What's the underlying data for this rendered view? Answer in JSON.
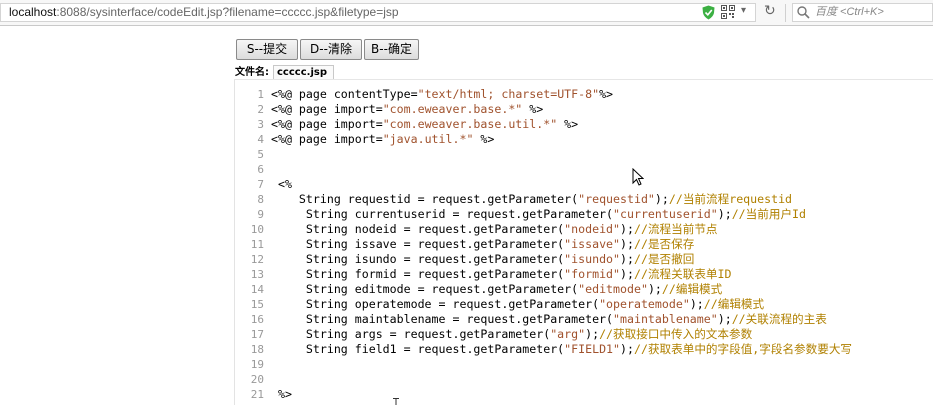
{
  "browser": {
    "url_host": "localhost",
    "url_rest": ":8088/sysinterface/codeEdit.jsp?filename=ccccc.jsp&filetype=jsp",
    "search_placeholder": "百度 <Ctrl+K>",
    "icons": [
      "shield-icon",
      "qr-code-icon",
      "dropdown-caret-icon",
      "reload-icon",
      "search-icon"
    ]
  },
  "toolbar": {
    "submit_label": "S--提交",
    "clear_label": "D--清除",
    "confirm_label": "B--确定"
  },
  "file": {
    "label": "文件名:",
    "name": "ccccc.jsp"
  },
  "editor": {
    "lines": [
      [
        {
          "t": "<%@ page contentType="
        },
        {
          "s": "\"text/html; charset=UTF-8\""
        },
        {
          "t": "%>"
        }
      ],
      [
        {
          "t": "<%@ page import="
        },
        {
          "s": "\"com.eweaver.base.*\""
        },
        {
          "t": " %>"
        }
      ],
      [
        {
          "t": "<%@ page import="
        },
        {
          "s": "\"com.eweaver.base.util.*\""
        },
        {
          "t": " %>"
        }
      ],
      [
        {
          "t": "<%@ page import="
        },
        {
          "s": "\"java.util.*\""
        },
        {
          "t": " %>"
        }
      ],
      [],
      [],
      [
        {
          "t": " <%"
        }
      ],
      [
        {
          "t": "    String requestid = request.getParameter("
        },
        {
          "s": "\"requestid\""
        },
        {
          "t": ");"
        },
        {
          "c": "//当前流程requestid"
        }
      ],
      [
        {
          "t": "     String currentuserid = request.getParameter("
        },
        {
          "s": "\"currentuserid\""
        },
        {
          "t": ");"
        },
        {
          "c": "//当前用户Id"
        }
      ],
      [
        {
          "t": "     String nodeid = request.getParameter("
        },
        {
          "s": "\"nodeid\""
        },
        {
          "t": ");"
        },
        {
          "c": "//流程当前节点"
        }
      ],
      [
        {
          "t": "     String issave = request.getParameter("
        },
        {
          "s": "\"issave\""
        },
        {
          "t": ");"
        },
        {
          "c": "//是否保存"
        }
      ],
      [
        {
          "t": "     String isundo = request.getParameter("
        },
        {
          "s": "\"isundo\""
        },
        {
          "t": ");"
        },
        {
          "c": "//是否撤回"
        }
      ],
      [
        {
          "t": "     String formid = request.getParameter("
        },
        {
          "s": "\"formid\""
        },
        {
          "t": ");"
        },
        {
          "c": "//流程关联表单ID"
        }
      ],
      [
        {
          "t": "     String editmode = request.getParameter("
        },
        {
          "s": "\"editmode\""
        },
        {
          "t": ");"
        },
        {
          "c": "//编辑模式"
        }
      ],
      [
        {
          "t": "     String operatemode = request.getParameter("
        },
        {
          "s": "\"operatemode\""
        },
        {
          "t": ");"
        },
        {
          "c": "//编辑模式"
        }
      ],
      [
        {
          "t": "     String maintablename = request.getParameter("
        },
        {
          "s": "\"maintablename\""
        },
        {
          "t": ");"
        },
        {
          "c": "//关联流程的主表"
        }
      ],
      [
        {
          "t": "     String args = request.getParameter("
        },
        {
          "s": "\"arg\""
        },
        {
          "t": ");"
        },
        {
          "c": "//获取接口中传入的文本参数"
        }
      ],
      [
        {
          "t": "     String field1 = request.getParameter("
        },
        {
          "s": "\"FIELD1\""
        },
        {
          "t": ");"
        },
        {
          "c": "//获取表单中的字段值,字段名参数要大写"
        }
      ],
      [],
      [],
      [
        {
          "t": " %>"
        }
      ],
      []
    ]
  }
}
